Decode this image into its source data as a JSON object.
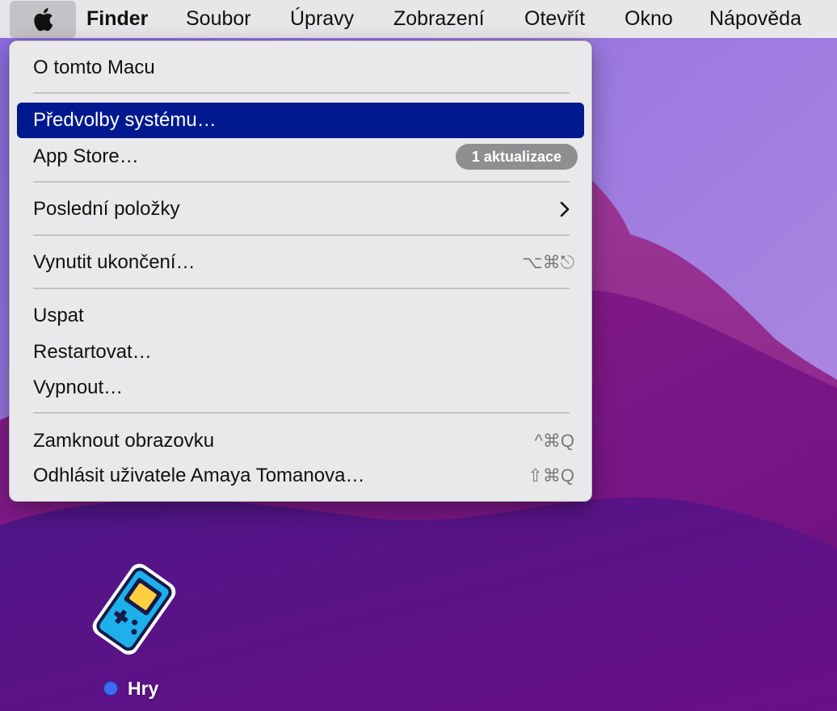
{
  "menubar": {
    "app_name": "Finder",
    "items": [
      "Soubor",
      "Úpravy",
      "Zobrazení",
      "Otevřít",
      "Okno",
      "Nápověda"
    ]
  },
  "apple_menu": {
    "about": "O tomto Macu",
    "system_preferences": "Předvolby systému…",
    "app_store": "App Store…",
    "app_store_badge": "1 aktualizace",
    "recent_items": "Poslední položky",
    "force_quit": "Vynutit ukončení…",
    "force_quit_shortcut": "⌥⌘⎋",
    "sleep": "Uspat",
    "restart": "Restartovat…",
    "shut_down": "Vypnout…",
    "lock_screen": "Zamknout obrazovku",
    "lock_screen_shortcut": "^⌘Q",
    "log_out": "Odhlásit uživatele Amaya Tomanova…",
    "log_out_shortcut": "⇧⌘Q"
  },
  "desktop": {
    "icon_name": "gamepad-icon",
    "icon_label": "Hry",
    "tag_color": "#3c6cf5"
  },
  "colors": {
    "highlight": "#00198e",
    "menubar": "#e8e6e9",
    "menu_bg": "#e9e8ea"
  }
}
